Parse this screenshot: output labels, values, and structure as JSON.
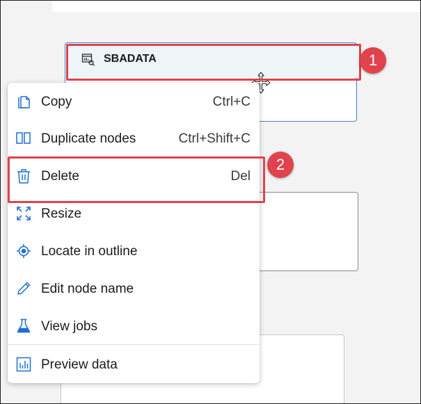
{
  "node": {
    "title": "SBADATA"
  },
  "badges": [
    "1",
    "2"
  ],
  "menu": {
    "items": [
      {
        "label": "Copy",
        "shortcut": "Ctrl+C",
        "icon": "copy-icon"
      },
      {
        "label": "Duplicate nodes",
        "shortcut": "Ctrl+Shift+C",
        "icon": "duplicate-icon"
      },
      {
        "label": "Delete",
        "shortcut": "Del",
        "icon": "trash-icon"
      },
      {
        "label": "Resize",
        "shortcut": "",
        "icon": "resize-icon"
      },
      {
        "label": "Locate in outline",
        "shortcut": "",
        "icon": "locate-icon"
      },
      {
        "label": "Edit node name",
        "shortcut": "",
        "icon": "pencil-icon"
      },
      {
        "label": "View jobs",
        "shortcut": "",
        "icon": "flask-icon"
      },
      {
        "label": "Preview data",
        "shortcut": "",
        "icon": "bar-chart-icon"
      }
    ]
  },
  "colors": {
    "accent": "#1f6fd1",
    "highlight": "#e0434b",
    "selection": "#3b82d6"
  }
}
